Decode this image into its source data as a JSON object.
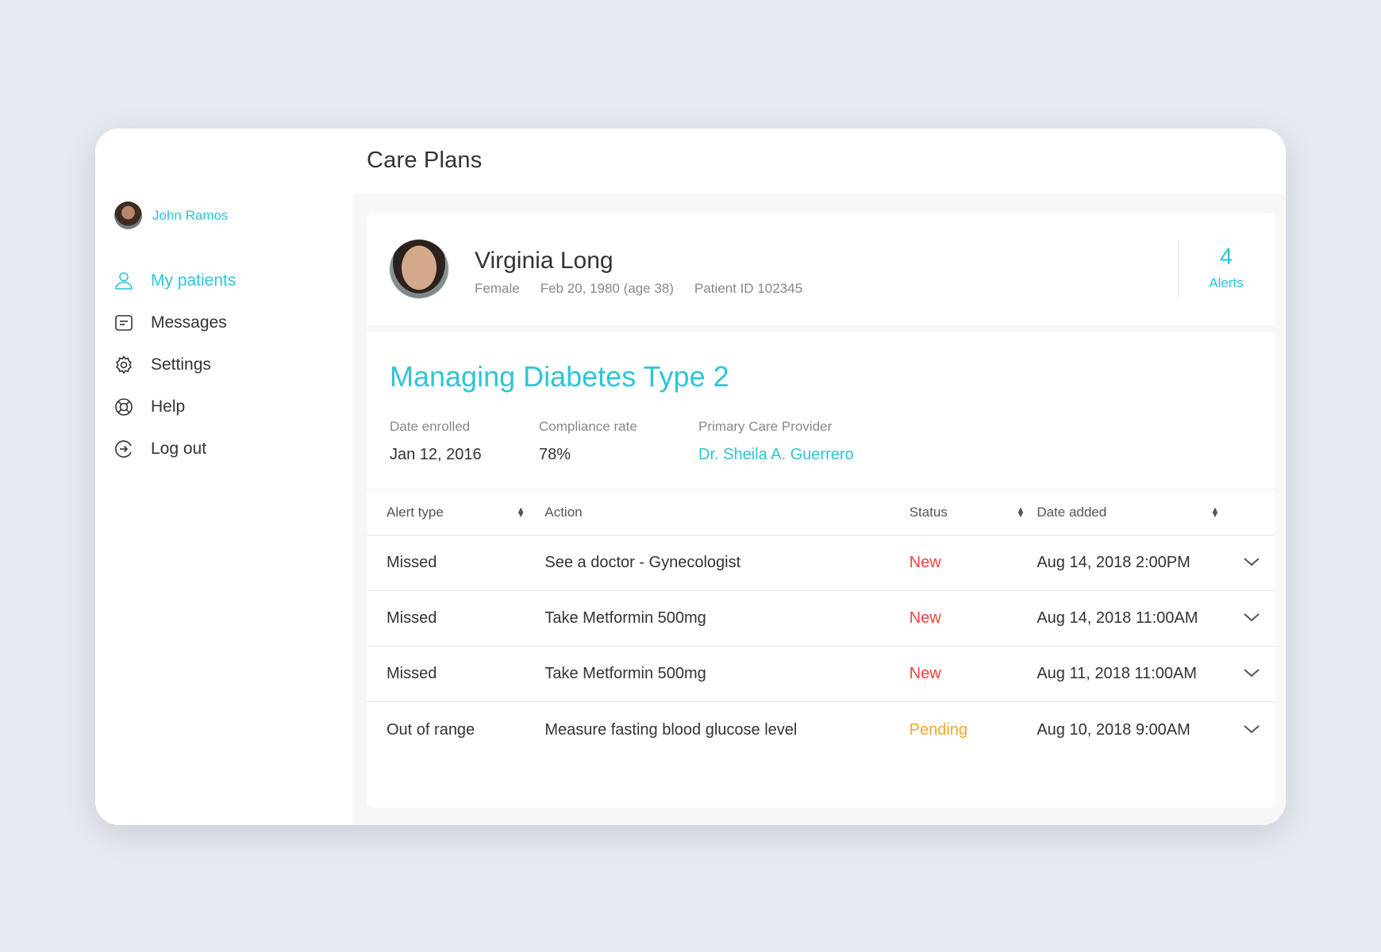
{
  "page": {
    "title": "Care Plans"
  },
  "user": {
    "name": "John Ramos"
  },
  "nav": [
    {
      "label": "My patients",
      "icon": "user-icon",
      "active": true
    },
    {
      "label": "Messages",
      "icon": "message-icon",
      "active": false
    },
    {
      "label": "Settings",
      "icon": "gear-icon",
      "active": false
    },
    {
      "label": "Help",
      "icon": "lifebuoy-icon",
      "active": false
    },
    {
      "label": "Log out",
      "icon": "logout-icon",
      "active": false
    }
  ],
  "patient": {
    "name": "Virginia Long",
    "gender": "Female",
    "dob": "Feb 20, 1980 (age 38)",
    "patient_id": "Patient ID 102345",
    "alerts_count": "4",
    "alerts_label": "Alerts"
  },
  "plan": {
    "title": "Managing Diabetes Type 2",
    "fields": {
      "date_enrolled_label": "Date enrolled",
      "date_enrolled": "Jan 12, 2016",
      "compliance_label": "Compliance rate",
      "compliance": "78%",
      "provider_label": "Primary Care Provider",
      "provider": "Dr. Sheila A. Guerrero"
    }
  },
  "table": {
    "headers": {
      "alert_type": "Alert type",
      "action": "Action",
      "status": "Status",
      "date_added": "Date added"
    },
    "rows": [
      {
        "alert_type": "Missed",
        "action": "See a doctor - Gynecologist",
        "status": "New",
        "date_added": "Aug 14, 2018 2:00PM"
      },
      {
        "alert_type": "Missed",
        "action": "Take Metformin 500mg",
        "status": "New",
        "date_added": "Aug 14, 2018 11:00AM"
      },
      {
        "alert_type": "Missed",
        "action": "Take Metformin 500mg",
        "status": "New",
        "date_added": "Aug 11, 2018 11:00AM"
      },
      {
        "alert_type": "Out of range",
        "action": "Measure fasting blood glucose level",
        "status": "Pending",
        "date_added": "Aug 10, 2018 9:00AM"
      }
    ]
  },
  "colors": {
    "accent": "#2ec4d6",
    "status_new": "#f0433c",
    "status_pending": "#f5a623",
    "background": "#e5e9f1"
  }
}
